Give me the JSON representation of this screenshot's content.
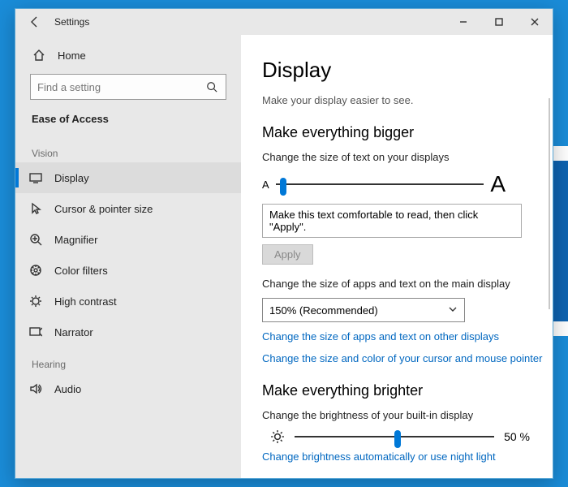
{
  "titlebar": {
    "title": "Settings"
  },
  "sidebar": {
    "home": "Home",
    "search_placeholder": "Find a setting",
    "category": "Ease of Access",
    "groups": {
      "vision": "Vision",
      "hearing": "Hearing"
    },
    "items": {
      "display": "Display",
      "cursor": "Cursor & pointer size",
      "magnifier": "Magnifier",
      "colorfilters": "Color filters",
      "highcontrast": "High contrast",
      "narrator": "Narrator",
      "audio": "Audio"
    }
  },
  "main": {
    "heading": "Display",
    "subtitle": "Make your display easier to see.",
    "section_bigger": "Make everything bigger",
    "text_size_label": "Change the size of text on your displays",
    "sample_text": "Make this text comfortable to read, then click \"Apply\".",
    "apply": "Apply",
    "apps_size_label": "Change the size of apps and text on the main display",
    "scale_value": "150% (Recommended)",
    "link_other_displays": "Change the size of apps and text on other displays",
    "link_cursor": "Change the size and color of your cursor and mouse pointer",
    "section_brighter": "Make everything brighter",
    "brightness_label": "Change the brightness of your built-in display",
    "brightness_value": "50 %",
    "link_nightlight": "Change brightness automatically or use night light",
    "slider_text_percent": 2,
    "slider_brightness_percent": 50
  }
}
